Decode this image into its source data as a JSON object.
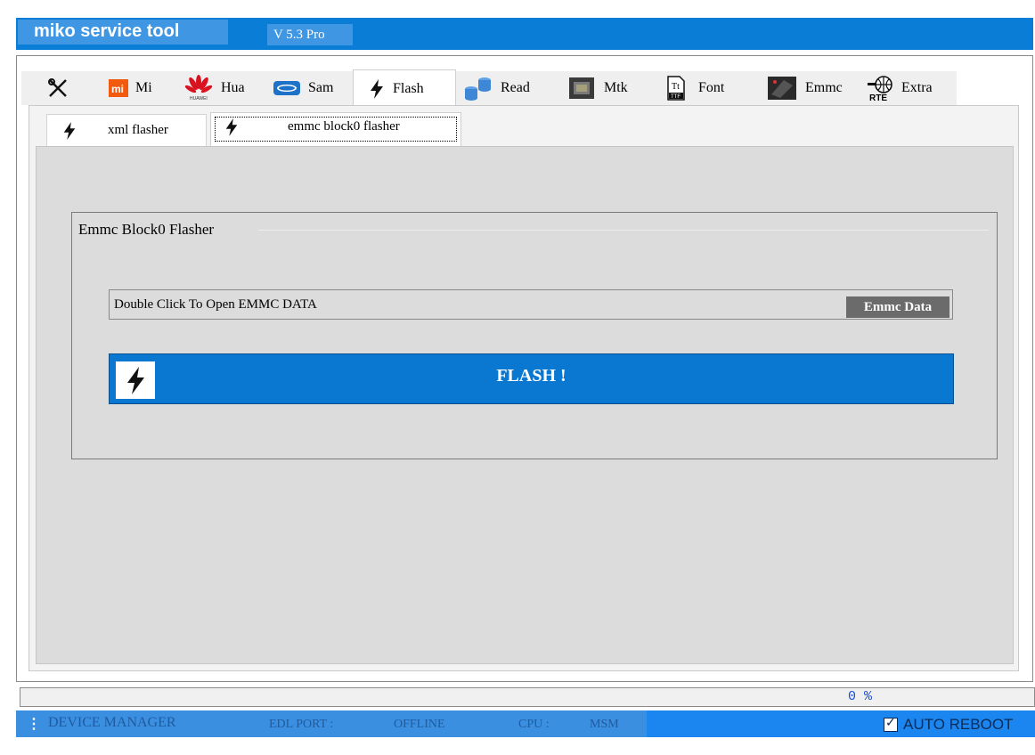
{
  "window": {
    "title": "miko service tool",
    "version": "V 5.3 Pro"
  },
  "tabs": [
    {
      "label": "",
      "icon": "tools-icon"
    },
    {
      "label": "Mi",
      "icon": "xiaomi-icon"
    },
    {
      "label": "Hua",
      "icon": "huawei-icon"
    },
    {
      "label": "Sam",
      "icon": "samsung-icon"
    },
    {
      "label": "Flash",
      "icon": "lightning-icon",
      "active": true
    },
    {
      "label": "Read",
      "icon": "database-icon"
    },
    {
      "label": "Mtk",
      "icon": "chip-icon"
    },
    {
      "label": "Font",
      "icon": "font-file-icon"
    },
    {
      "label": "Emmc",
      "icon": "emmc-chip-icon"
    },
    {
      "label": "Extra",
      "icon": "globe-icon"
    }
  ],
  "subtabs": [
    {
      "label": "xml flasher",
      "icon": "lightning-icon"
    },
    {
      "label": "emmc block0 flasher",
      "icon": "lightning-icon",
      "active": true
    }
  ],
  "group": {
    "title": "Emmc Block0 Flasher",
    "file_field": "Double Click To Open EMMC DATA",
    "emmc_button": "Emmc Data",
    "flash_button": "FLASH !"
  },
  "progress": {
    "percent_text": "0 %",
    "value": 0
  },
  "status": {
    "device_manager": "DEVICE MANAGER",
    "edl_port_label": "EDL PORT :",
    "edl_port_value": "OFFLINE",
    "cpu_label": "CPU :",
    "cpu_value": "MSM",
    "auto_reboot": "AUTO REBOOT",
    "auto_reboot_checked": true
  },
  "colors": {
    "accent": "#0a77d0",
    "titlebar": "#0a7ed6",
    "status": "#3b8fe0"
  }
}
